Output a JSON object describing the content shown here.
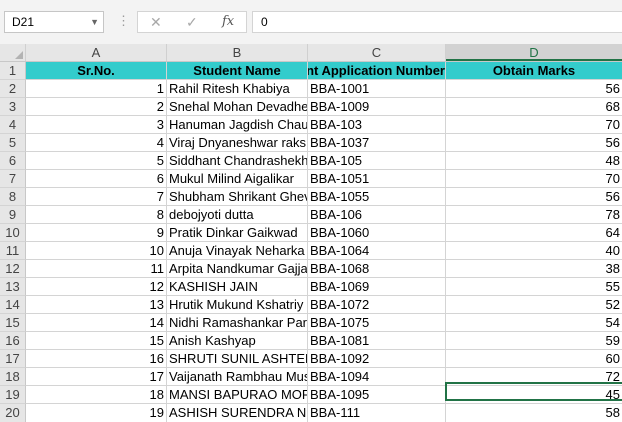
{
  "formula_bar": {
    "name_box": "D21",
    "formula": "0",
    "fx_label": "fx",
    "cancel_glyph": "✕",
    "enter_glyph": "✓"
  },
  "columns": [
    "A",
    "B",
    "C",
    "D"
  ],
  "selected_column": "D",
  "header_row": {
    "row_number": "1",
    "cells": [
      "Sr.No.",
      "Student Name",
      "Student Application Number",
      "Obtain Marks"
    ],
    "fill_color": "#33cccc"
  },
  "rows": [
    {
      "n": "2",
      "sr": "1",
      "name": "Rahil Ritesh Khabiya",
      "app": "BBA-1001",
      "marks": "56"
    },
    {
      "n": "3",
      "sr": "2",
      "name": "Snehal Mohan Devadhe",
      "app": "BBA-1009",
      "marks": "68"
    },
    {
      "n": "4",
      "sr": "3",
      "name": "Hanuman Jagdish Chau",
      "app": "BBA-103",
      "marks": "70"
    },
    {
      "n": "5",
      "sr": "4",
      "name": "Viraj Dnyaneshwar raks",
      "app": "BBA-1037",
      "marks": "56"
    },
    {
      "n": "6",
      "sr": "5",
      "name": "Siddhant Chandrashekh",
      "app": "BBA-105",
      "marks": "48"
    },
    {
      "n": "7",
      "sr": "6",
      "name": "Mukul Milind Aigalikar",
      "app": "BBA-1051",
      "marks": "70"
    },
    {
      "n": "8",
      "sr": "7",
      "name": "Shubham Shrikant Ghev",
      "app": "BBA-1055",
      "marks": "56"
    },
    {
      "n": "9",
      "sr": "8",
      "name": "debojyoti  dutta",
      "app": "BBA-106",
      "marks": "78"
    },
    {
      "n": "10",
      "sr": "9",
      "name": "Pratik Dinkar Gaikwad",
      "app": "BBA-1060",
      "marks": "64"
    },
    {
      "n": "11",
      "sr": "10",
      "name": "Anuja Vinayak Neharka",
      "app": "BBA-1064",
      "marks": "40"
    },
    {
      "n": "12",
      "sr": "11",
      "name": "Arpita Nandkumar Gajja",
      "app": "BBA-1068",
      "marks": "38"
    },
    {
      "n": "13",
      "sr": "12",
      "name": "KASHISH  JAIN",
      "app": "BBA-1069",
      "marks": "55"
    },
    {
      "n": "14",
      "sr": "13",
      "name": "Hrutik Mukund Kshatriy",
      "app": "BBA-1072",
      "marks": "52"
    },
    {
      "n": "15",
      "sr": "14",
      "name": "Nidhi Ramashankar Par",
      "app": "BBA-1075",
      "marks": "54"
    },
    {
      "n": "16",
      "sr": "15",
      "name": "Anish  Kashyap",
      "app": "BBA-1081",
      "marks": "59"
    },
    {
      "n": "17",
      "sr": "16",
      "name": "SHRUTI SUNIL ASHTEK",
      "app": "BBA-1092",
      "marks": "60"
    },
    {
      "n": "18",
      "sr": "17",
      "name": "Vaijanath Rambhau Mus",
      "app": "BBA-1094",
      "marks": "72"
    },
    {
      "n": "19",
      "sr": "18",
      "name": "MANSI BAPURAO MOR",
      "app": "BBA-1095",
      "marks": "45"
    },
    {
      "n": "20",
      "sr": "19",
      "name": "ASHISH SURENDRA N",
      "app": "BBA-111",
      "marks": "58"
    }
  ],
  "accent_color": "#217346"
}
